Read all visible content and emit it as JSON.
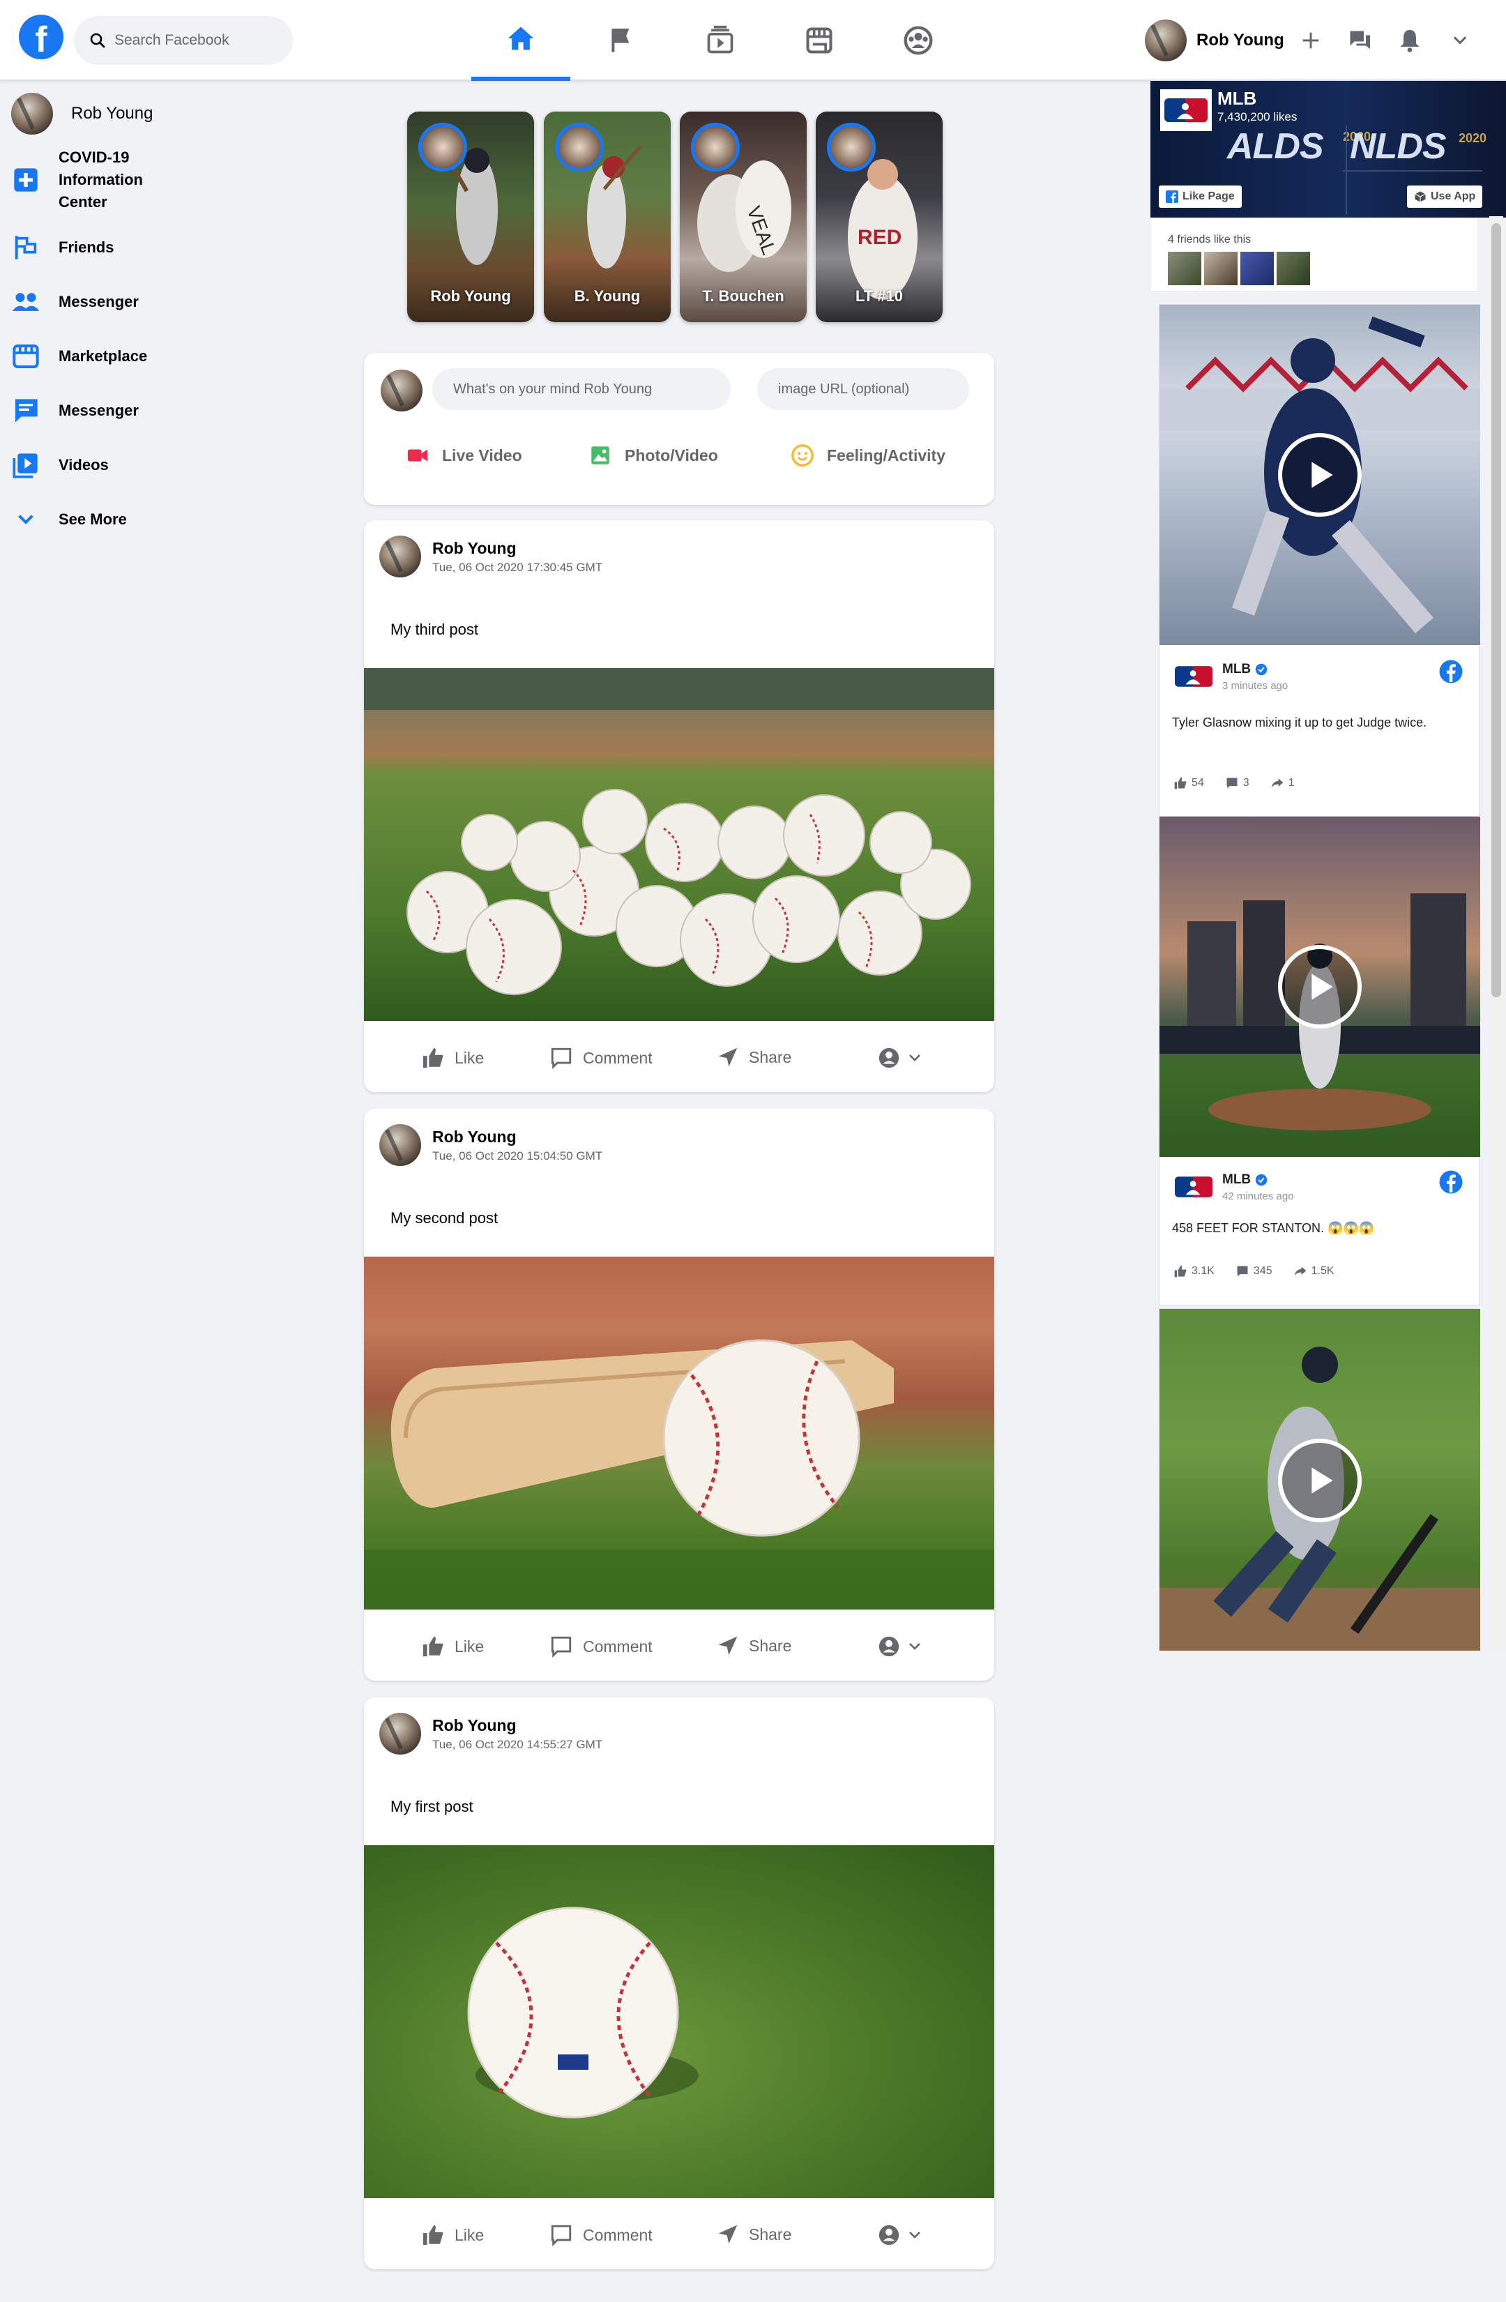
{
  "header": {
    "logo": "f",
    "search_placeholder": "Search Facebook",
    "user_name": "Rob Young",
    "nav_icons": [
      "home-icon",
      "flag-icon",
      "watch-icon",
      "marketplace-icon",
      "groups-icon"
    ],
    "right_icons": [
      "plus-icon",
      "messenger-icon",
      "bell-icon",
      "chevron-down-icon"
    ]
  },
  "sidebar": {
    "profile_name": "Rob Young",
    "items": [
      {
        "label": "COVID-19 Information Center",
        "icon": "covid-plus-icon"
      },
      {
        "label": "Friends",
        "icon": "friends-flag-icon"
      },
      {
        "label": "Messenger",
        "icon": "people-icon"
      },
      {
        "label": "Marketplace",
        "icon": "marketplace-icon"
      },
      {
        "label": "Messenger",
        "icon": "chat-icon"
      },
      {
        "label": "Videos",
        "icon": "videos-icon"
      },
      {
        "label": "See More",
        "icon": "chevron-down-icon"
      }
    ]
  },
  "stories": [
    {
      "name": "Rob Young"
    },
    {
      "name": "B. Young"
    },
    {
      "name": "T. Bouchen"
    },
    {
      "name": "LT #10"
    }
  ],
  "composer": {
    "text_placeholder": "What's on your mind Rob Young",
    "url_placeholder": "image URL (optional)",
    "actions": [
      "Live Video",
      "Photo/Video",
      "Feeling/Activity"
    ]
  },
  "posts": [
    {
      "author": "Rob Young",
      "time": "Tue, 06 Oct 2020 17:30:45 GMT",
      "text": "My third post"
    },
    {
      "author": "Rob Young",
      "time": "Tue, 06 Oct 2020 15:04:50 GMT",
      "text": "My second post"
    },
    {
      "author": "Rob Young",
      "time": "Tue, 06 Oct 2020 14:55:27 GMT",
      "text": "My first post"
    }
  ],
  "post_actions": {
    "like": "Like",
    "comment": "Comment",
    "share": "Share"
  },
  "right": {
    "page_name": "MLB",
    "likes": "7,430,200 likes",
    "like_page": "Like Page",
    "use_app": "Use App",
    "banner_left": "ALDS",
    "banner_right": "NLDS",
    "year": "2020",
    "friends_like": "4 friends like this",
    "posts": [
      {
        "author": "MLB",
        "time": "3 minutes ago",
        "text": "Tyler Glasnow mixing it up to get Judge twice.",
        "likes": "54",
        "comments": "3",
        "shares": "1"
      },
      {
        "author": "MLB",
        "time": "42 minutes ago",
        "text": "458 FEET FOR STANTON. 😱😱😱",
        "likes": "3.1K",
        "comments": "345",
        "shares": "1.5K"
      }
    ]
  },
  "colors": {
    "brand": "#1877f2",
    "background": "#f0f2f5",
    "live_red": "#f02849",
    "photo_green": "#45bd62",
    "feeling_yellow": "#f7b928"
  }
}
